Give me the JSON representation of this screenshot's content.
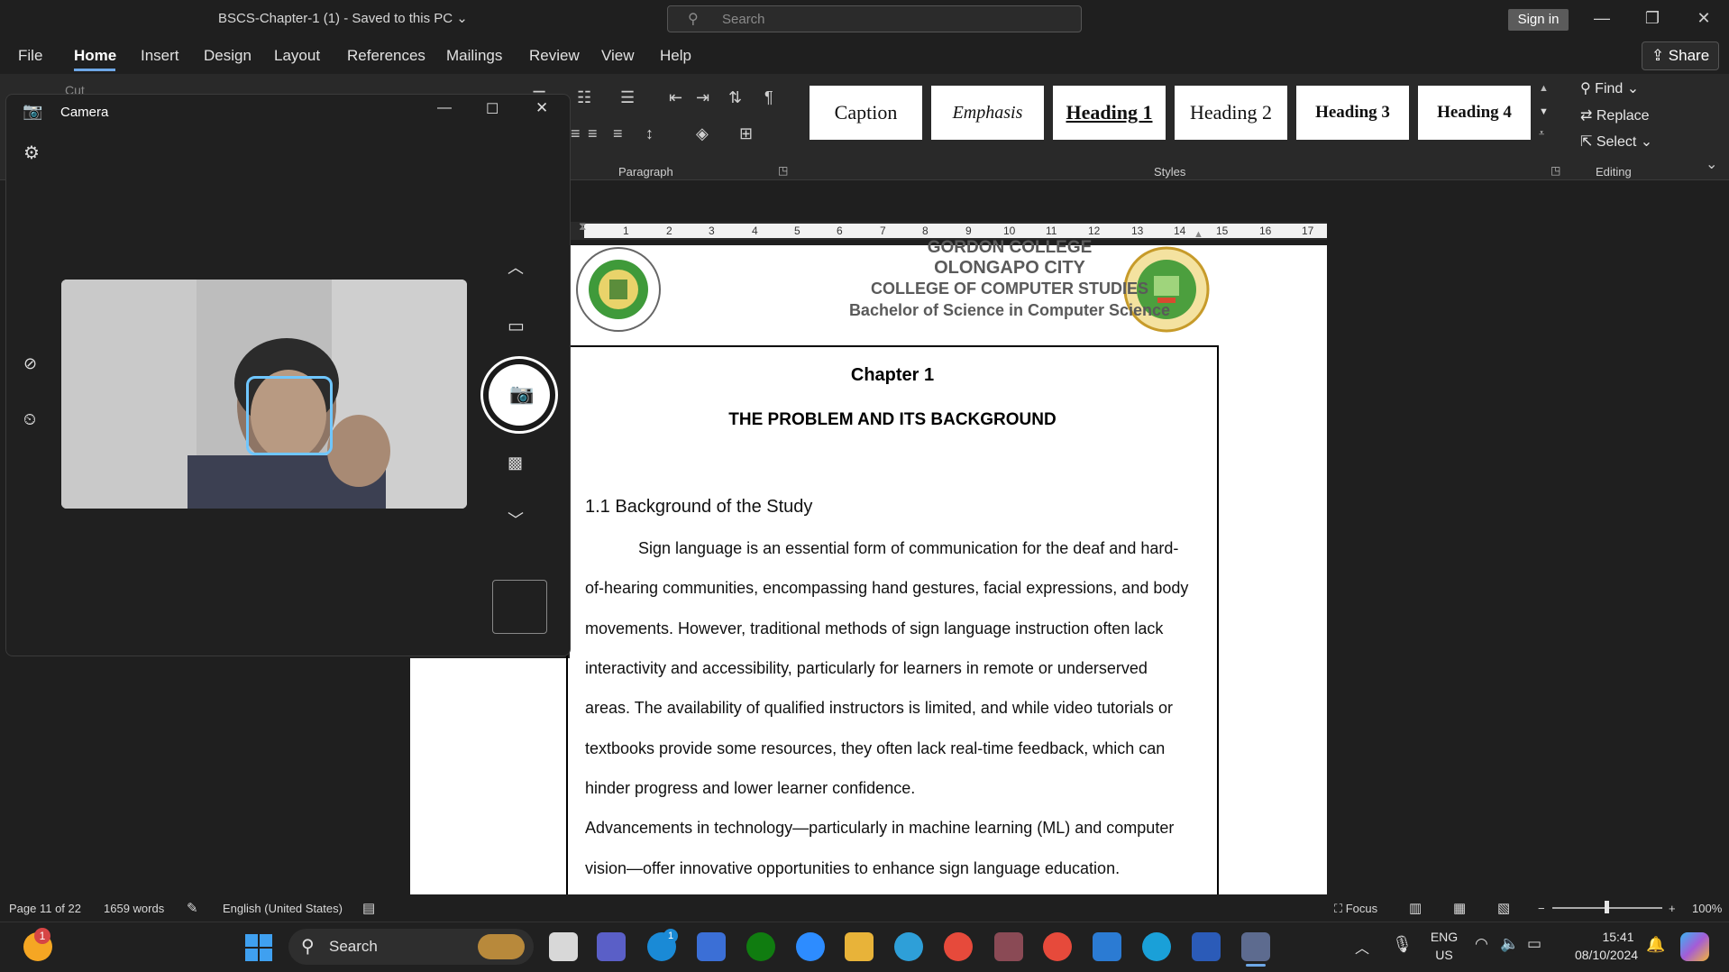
{
  "titlebar": {
    "doc_title": "BSCS-Chapter-1 (1)  -  Saved to this PC  ⌄",
    "search_placeholder": "Search",
    "signin_label": "Sign in"
  },
  "menu": {
    "items": [
      "File",
      "Home",
      "Insert",
      "Design",
      "Layout",
      "References",
      "Mailings",
      "Review",
      "View",
      "Help"
    ],
    "share_label": "Share"
  },
  "ribbon": {
    "cut_label": "Cut",
    "paragraph_label": "Paragraph",
    "styles_label": "Styles",
    "editing_label": "Editing",
    "styles": [
      "Caption",
      "Emphasis",
      "Heading 1",
      "Heading 2",
      "Heading 3",
      "Heading 4"
    ],
    "find_label": "Find",
    "replace_label": "Replace",
    "select_label": "Select"
  },
  "ruler": {
    "numbers": [
      "1",
      "2",
      "3",
      "4",
      "5",
      "6",
      "7",
      "8",
      "9",
      "10",
      "11",
      "12",
      "13",
      "14",
      "15",
      "16",
      "17"
    ]
  },
  "document": {
    "header": {
      "line1": "GORDON COLLEGE",
      "line2": "OLONGAPO CITY",
      "line3": "COLLEGE OF COMPUTER STUDIES",
      "line4": "Bachelor of Science in Computer Science"
    },
    "chapter": "Chapter 1",
    "chapter_title": "THE PROBLEM AND ITS BACKGROUND",
    "section": "1.1 Background of the Study",
    "lines": [
      "Sign language is an essential form of communication for the deaf and hard-",
      "of-hearing communities, encompassing hand gestures, facial expressions, and body",
      "movements. However, traditional methods of sign language instruction often lack",
      "interactivity and accessibility, particularly for learners in remote or underserved",
      "areas. The availability of qualified instructors is limited, and while video tutorials or",
      "textbooks provide some resources, they often lack real-time feedback, which can",
      "hinder progress and lower learner confidence.",
      "Advancements in technology—particularly in machine learning (ML) and computer",
      "vision—offer innovative opportunities to enhance sign language education."
    ]
  },
  "statusbar": {
    "page": "Page 11 of 22",
    "words": "1659 words",
    "language": "English (United States)",
    "focus": "Focus",
    "zoom": "100%"
  },
  "camera": {
    "title": "Camera"
  },
  "taskbar": {
    "search_label": "Search",
    "notification_count": "1",
    "skype_badge": "1",
    "lang_line1": "ENG",
    "lang_line2": "US",
    "time": "15:41",
    "date": "08/10/2024"
  }
}
